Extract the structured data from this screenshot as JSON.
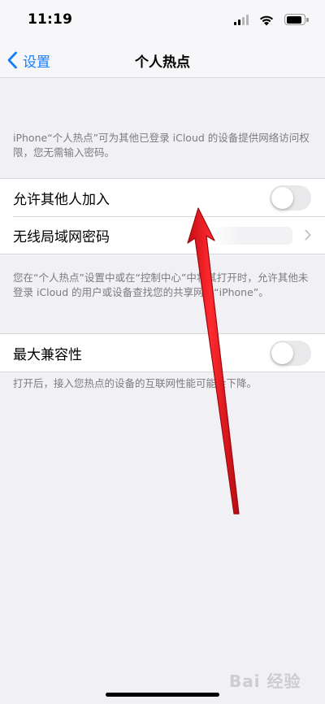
{
  "status_bar": {
    "time": "11:19",
    "icons": [
      "cellular-signal-icon",
      "wifi-icon",
      "battery-icon"
    ]
  },
  "nav": {
    "back_label": "设置",
    "title": "个人热点"
  },
  "intro_note": "iPhone“个人热点”可为其他已登录 iCloud 的设备提供网络访问权限，您无需输入密码。",
  "settings": {
    "allow_others": {
      "label": "允许其他人加入",
      "enabled": false
    },
    "wifi_password": {
      "label": "无线局域网密码"
    }
  },
  "control_center_note": "您在“个人热点”设置中或在“控制中心”中将其打开时，允许其他未登录 iCloud 的用户或设备查找您的共享网络“iPhone”。",
  "compatibility": {
    "label": "最大兼容性",
    "enabled": false
  },
  "compatibility_note": "打开后，接入您热点的设备的互联网性能可能会下降。",
  "watermark": "Bai 经验",
  "colors": {
    "accent": "#147efb",
    "background": "#f0f0f5",
    "arrow": "#e8141b"
  }
}
